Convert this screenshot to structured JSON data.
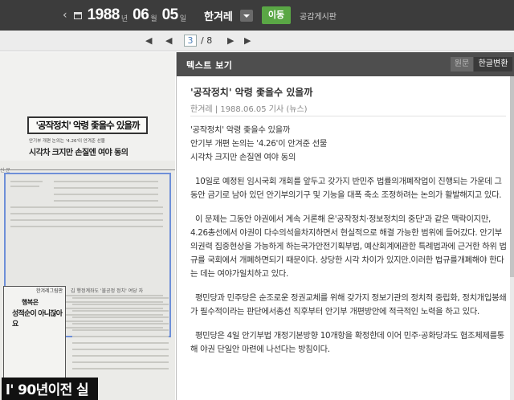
{
  "header": {
    "prev_icon": "chevron-left-icon",
    "calendar_icon": "calendar-icon",
    "year": "1988",
    "year_unit": "년",
    "month": "06",
    "month_unit": "월",
    "day": "05",
    "day_unit": "일",
    "newspaper": "한겨레",
    "go_label": "이동",
    "board_label": "공감게시판"
  },
  "pagination": {
    "current_page": "3",
    "total_pages": "/ 8"
  },
  "scan": {
    "masthead_text": "신 문",
    "headline": "'공작정치' 악령 좇을수 있을까",
    "subheadline_small": "안기부 개편 논의는 '4.26'이 안겨준 선물",
    "subheadline": "시각차 크지만 손질엔 여야 동의",
    "cartoon_header": "한겨레그림판",
    "cartoon_line1": "행복은",
    "cartoon_line2": "성적순이 아니잖아요",
    "caption": "김 행정계좌도 '불공정 정치' 여당 자",
    "big_headline": "l' 90년이전 실시"
  },
  "panel": {
    "title": "텍스트 보기",
    "tab_original": "원문",
    "tab_converted": "한글변환",
    "article_title": "'공작정치' 악령 좇을수 있을까",
    "article_meta": "한겨레 | 1988.06.05 기사 (뉴스)",
    "headline_lines": [
      "'공작정치' 악령 좇을수 있을까",
      "안기부 개편 논의는 '4.26'이 안겨준 선물",
      "시각차 크지만 손질엔 여야 동의"
    ],
    "paragraphs": [
      "10일로 예정된 임시국회 개회를 앞두고 갖가지 반민주 법률의개폐작업이 진행되는 가운데 그동안 금기로 남아 있던 안기부의기구 및 기능을 대폭 축소 조정하려는 논의가 활발해지고 있다.",
      "이 문제는 그동안 야권에서 계속 거론해 온'공작정치·정보정치의 중단'과 같은 맥락이지만, 4.26총선에서 야권이 다수의석을차지하면서 현실적으로 해결 가능한 범위에 들어갔다. 안기부의권력 집중현상을 가능하게 하는국가안전기획부법, 예산회계에관한 특례법과에 근거한 하위 법규를 국회에서 개폐하면되기 때문이다. 상당한 시각 차이가 있지만.이러한 법규를개폐해야 한다는 데는 여야가일치하고 있다.",
      "평민당과 민주당은 순조로운 정권교체를 위해 갖가지 정보기관의 정치적 중립화, 정치개입봉쇄가 필수적이라는 판단에서총선 직후부터 안기부 개편방안에 적극적인 노력을 하고 있다.",
      "평민당은 4일 안기부법 개정기본방향 10개항을 확정한데 이어 민주·공화당과도 협조체제를통해 야권 단일안 마련에 나선다는 방침이다."
    ]
  }
}
